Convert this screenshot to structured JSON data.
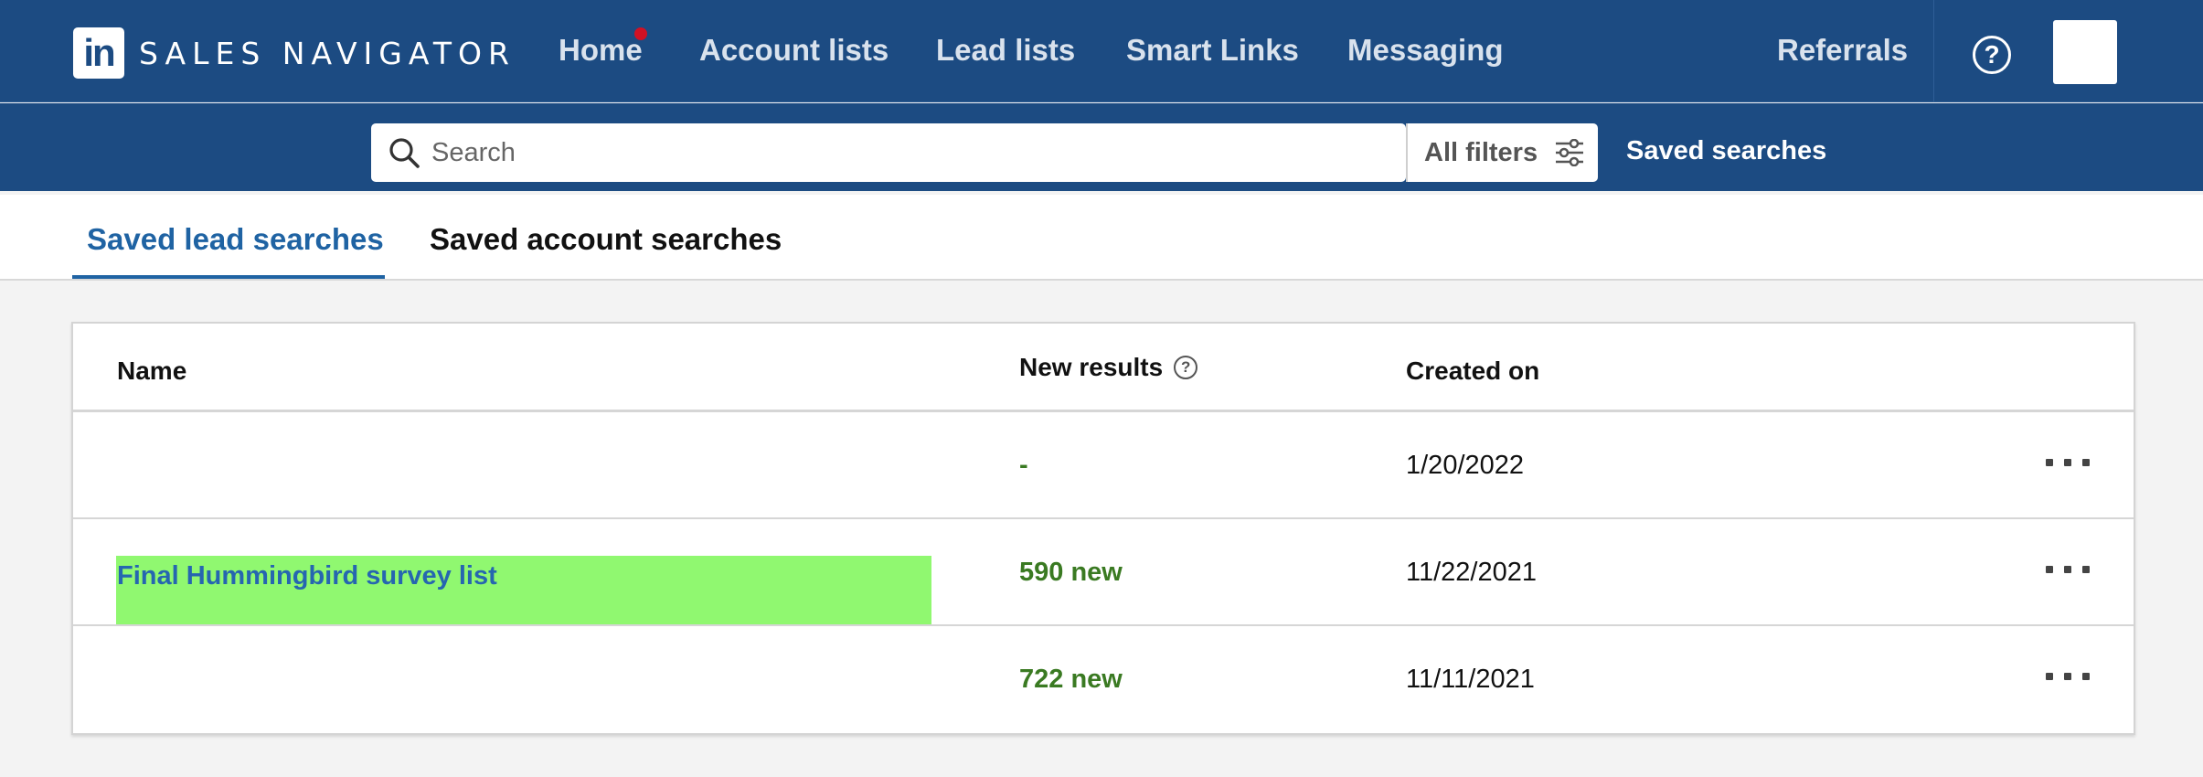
{
  "brand": {
    "logo_mark": "in",
    "product_name": "SALES NAVIGATOR"
  },
  "nav": {
    "items": [
      {
        "label": "Home",
        "has_notification": true
      },
      {
        "label": "Account lists"
      },
      {
        "label": "Lead lists"
      },
      {
        "label": "Smart Links"
      },
      {
        "label": "Messaging"
      }
    ],
    "referrals": "Referrals",
    "help_icon": "question-circle-icon"
  },
  "search": {
    "placeholder": "Search",
    "filters_label": "All filters",
    "saved_searches_label": "Saved searches"
  },
  "tabs": [
    {
      "label": "Saved lead searches",
      "active": true
    },
    {
      "label": "Saved account searches",
      "active": false
    }
  ],
  "table": {
    "columns": {
      "name": "Name",
      "new_results": "New results",
      "created_on": "Created on"
    },
    "rows": [
      {
        "name": "",
        "new_results": "-",
        "created_on": "1/20/2022"
      },
      {
        "name": "Final Hummingbird survey list",
        "new_results": "590 new",
        "created_on": "11/22/2021"
      },
      {
        "name": "",
        "new_results": "722 new",
        "created_on": "11/11/2021"
      }
    ]
  },
  "colors": {
    "nav_background": "#1c4b82",
    "active_tab": "#1f63a3",
    "new_results_text": "#3a7a22",
    "highlight": "#90f870",
    "notification_dot": "#d11124"
  }
}
